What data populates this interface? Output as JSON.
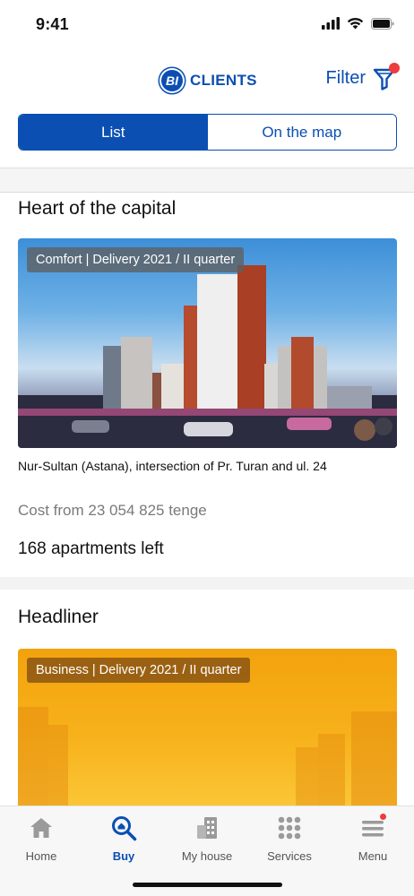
{
  "status_bar": {
    "time": "9:41"
  },
  "header": {
    "logo_badge": "BI",
    "logo_text": "CLIENTS",
    "filter_label": "Filter"
  },
  "view_toggle": {
    "list_label": "List",
    "map_label": "On the map",
    "active": "List"
  },
  "listings": [
    {
      "title": "Heart of the capital",
      "badge": "Comfort | Delivery 2021 / II quarter",
      "address": "Nur-Sultan (Astana), intersection of Pr. Turan and ul. 24",
      "cost": "Cost from 23 054 825 tenge",
      "apartments": "168 apartments left"
    },
    {
      "title": "Headliner",
      "badge": "Business | Delivery 2021 / II quarter"
    }
  ],
  "tabbar": {
    "items": [
      {
        "label": "Home",
        "icon": "home-icon"
      },
      {
        "label": "Buy",
        "icon": "search-icon"
      },
      {
        "label": "My house",
        "icon": "building-icon"
      },
      {
        "label": "Services",
        "icon": "grid-icon"
      },
      {
        "label": "Menu",
        "icon": "menu-icon"
      }
    ],
    "active": "Buy"
  },
  "colors": {
    "brand": "#0b4fb3",
    "notification": "#ef3b3b",
    "muted_text": "#7a7a7a"
  }
}
